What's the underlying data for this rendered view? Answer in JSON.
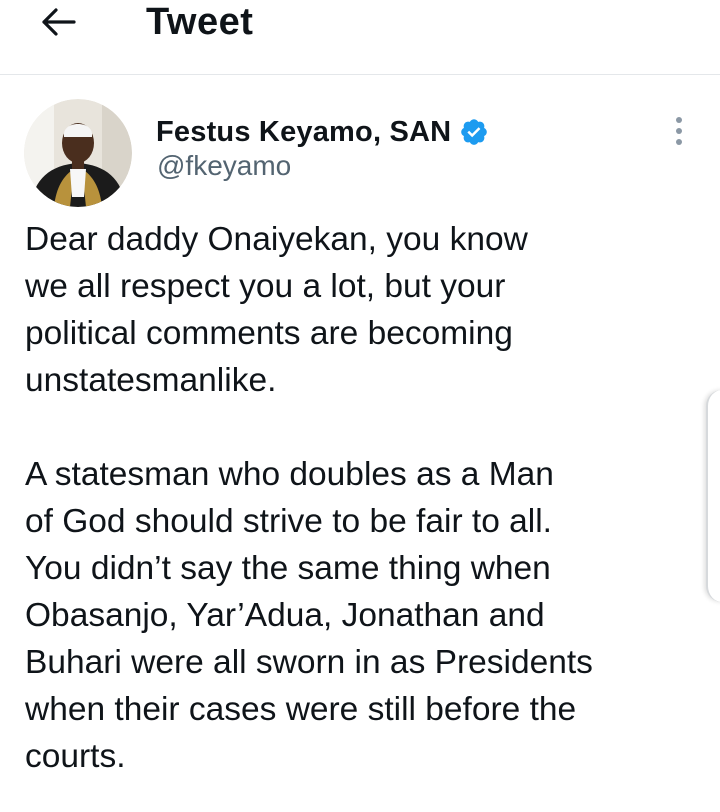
{
  "header": {
    "back_icon": "arrow-left-icon",
    "title": "Tweet"
  },
  "tweet": {
    "author": {
      "display_name": "Festus Keyamo, SAN",
      "handle": "@fkeyamo",
      "verified": true,
      "verified_color": "#1d9bf0"
    },
    "more_icon": "more-vertical-icon",
    "text": "Dear daddy Onaiyekan, you know\nwe all respect you a lot, but your\npolitical comments are becoming\nunstatesmanlike.\n\nA statesman who doubles as a Man\nof God should strive to be fair to all.\nYou didn’t say the same thing when\nObasanjo, Yar’Adua, Jonathan and\nBuhari were all sworn in as Presidents\nwhen their cases were still before the\ncourts."
  },
  "colors": {
    "text": "#0f1419",
    "secondary_text": "#536471",
    "divider": "#e4e7ea"
  }
}
